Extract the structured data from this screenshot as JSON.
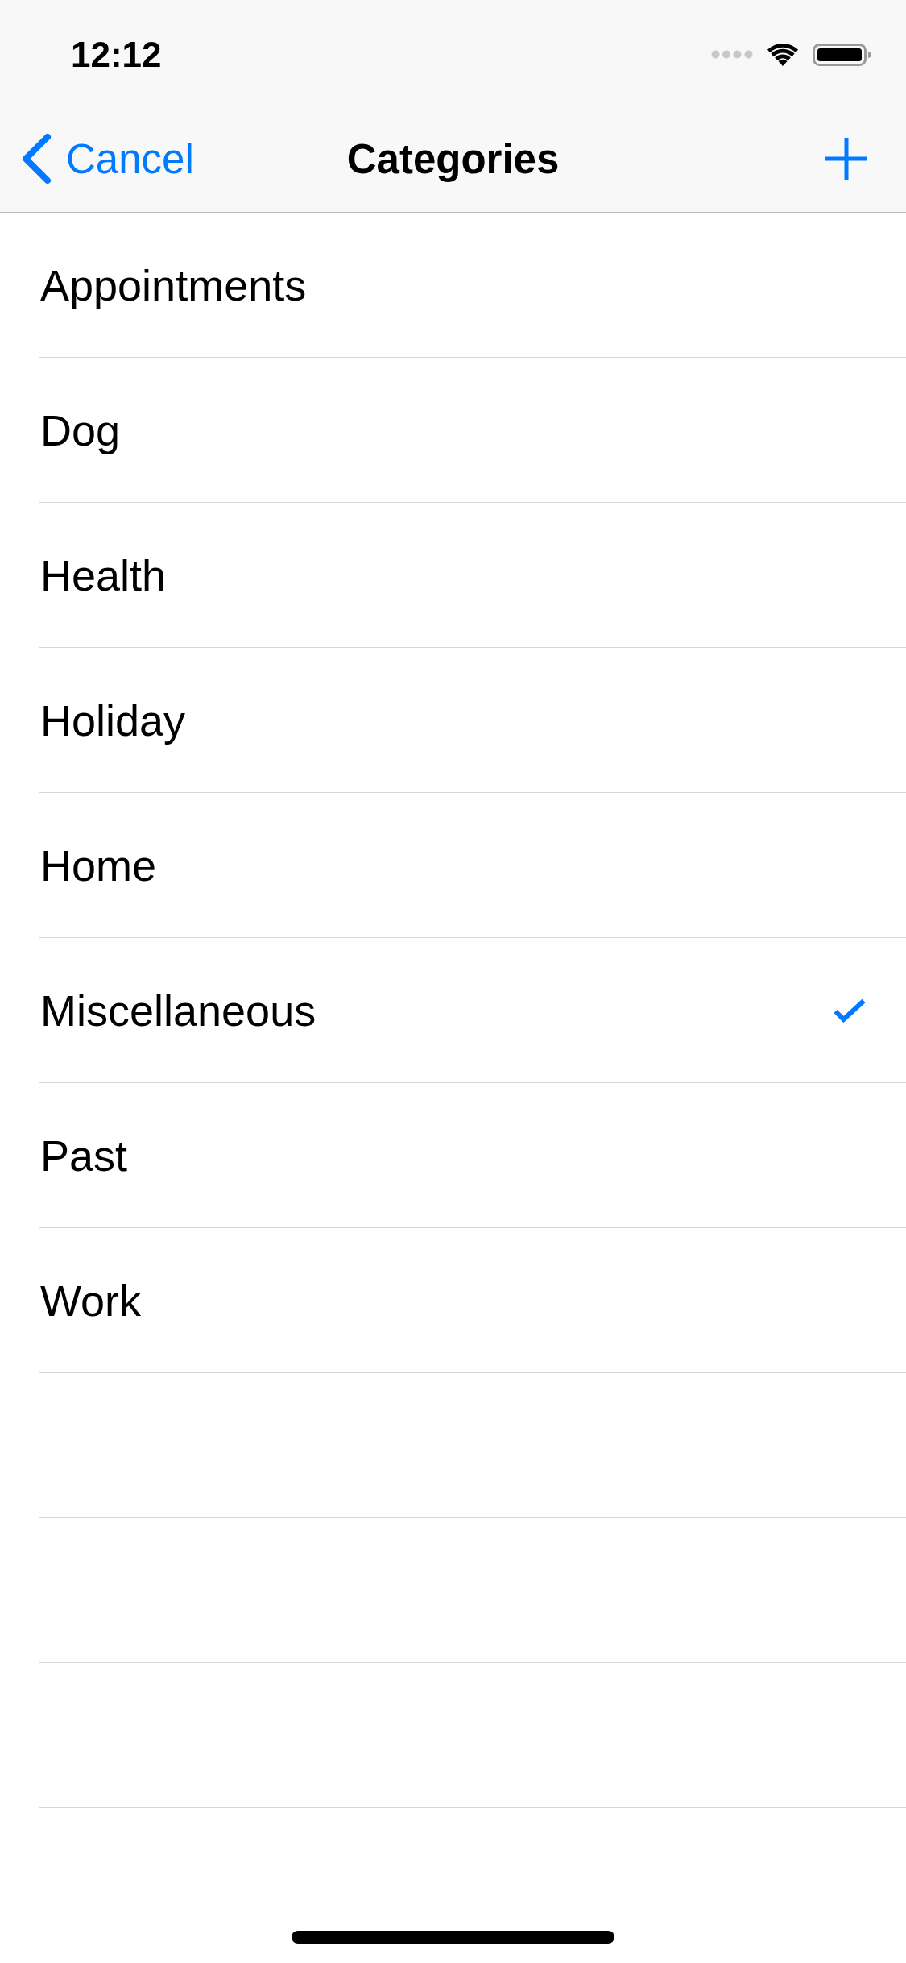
{
  "status_bar": {
    "time": "12:12"
  },
  "nav_bar": {
    "back_button": {
      "label": "Cancel"
    },
    "title": "Categories"
  },
  "categories": [
    {
      "name": "Appointments",
      "selected": false
    },
    {
      "name": "Dog",
      "selected": false
    },
    {
      "name": "Health",
      "selected": false
    },
    {
      "name": "Holiday",
      "selected": false
    },
    {
      "name": "Home",
      "selected": false
    },
    {
      "name": "Miscellaneous",
      "selected": true
    },
    {
      "name": "Past",
      "selected": false
    },
    {
      "name": "Work",
      "selected": false
    }
  ]
}
